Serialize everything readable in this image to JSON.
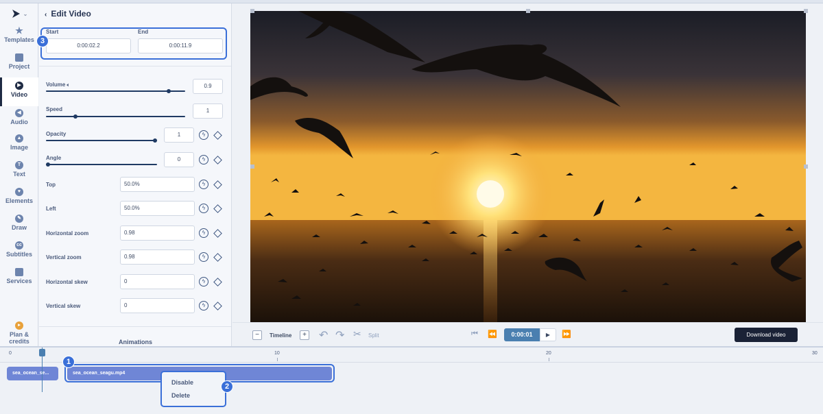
{
  "nav": {
    "items": [
      {
        "label": "Templates",
        "icon": "star-icon"
      },
      {
        "label": "Project",
        "icon": "grid-icon"
      },
      {
        "label": "Video",
        "icon": "play-circle-icon"
      },
      {
        "label": "Audio",
        "icon": "speaker-icon"
      },
      {
        "label": "Image",
        "icon": "image-icon"
      },
      {
        "label": "Text",
        "icon": "text-icon"
      },
      {
        "label": "Elements",
        "icon": "elements-icon"
      },
      {
        "label": "Draw",
        "icon": "pencil-icon"
      },
      {
        "label": "Subtitles",
        "icon": "cc-icon"
      },
      {
        "label": "Services",
        "icon": "grid-icon"
      }
    ],
    "plan_line1": "Plan &",
    "plan_line2": "credits"
  },
  "panel": {
    "title": "Edit Video",
    "start_label": "Start",
    "end_label": "End",
    "start_value": "0:00:02.2",
    "end_value": "0:00:11.9",
    "volume_label": "Volume",
    "volume_value": "0.9",
    "speed_label": "Speed",
    "speed_value": "1",
    "opacity_label": "Opacity",
    "opacity_value": "1",
    "angle_label": "Angle",
    "angle_value": "0",
    "top_label": "Top",
    "top_value": "50.0%",
    "left_label": "Left",
    "left_value": "50.0%",
    "hzoom_label": "Horizontal zoom",
    "hzoom_value": "0.98",
    "vzoom_label": "Vertical zoom",
    "vzoom_value": "0.98",
    "hskew_label": "Horizontal skew",
    "hskew_value": "0",
    "vskew_label": "Vertical skew",
    "vskew_value": "0",
    "animations_label": "Animations"
  },
  "controls": {
    "minus": "−",
    "timeline_label": "Timeline",
    "plus": "+",
    "split_label": "Split",
    "time": "0:00:01",
    "download_label": "Download video"
  },
  "timeline": {
    "ticks": [
      "0",
      "10",
      "20",
      "30"
    ],
    "clip1_label": "sea_ocean_se...",
    "clip2_label": "sea_ocean_seagu.mp4",
    "menu_disable": "Disable",
    "menu_delete": "Delete"
  },
  "badges": [
    "1",
    "2",
    "3"
  ]
}
